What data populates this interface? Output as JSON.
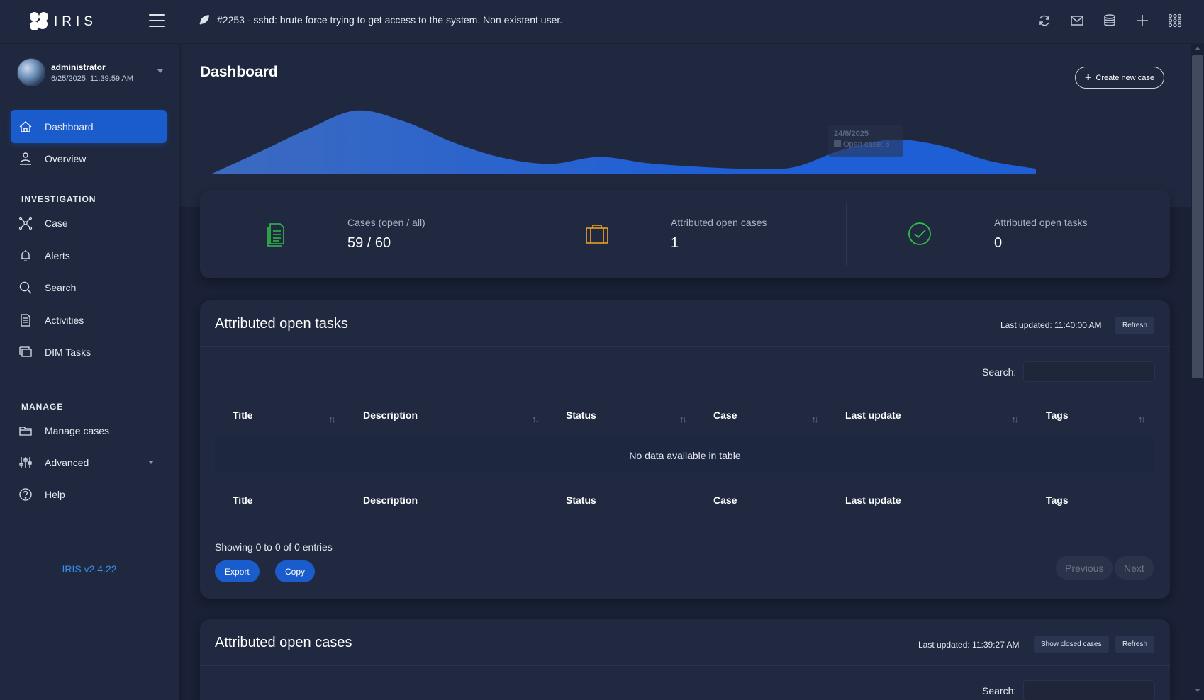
{
  "app": {
    "logo_text": "IRIS",
    "version": "IRIS v2.4.22"
  },
  "topbar": {
    "notification": "#2253 - sshd: brute force trying to get access to the system. Non existent user."
  },
  "user": {
    "name": "administrator",
    "date": "6/25/2025, 11:39:59 AM"
  },
  "sidebar": {
    "items_top": [
      {
        "label": "Dashboard",
        "icon": "home-icon",
        "active": true
      },
      {
        "label": "Overview",
        "icon": "overview-icon"
      }
    ],
    "section_investigation": "INVESTIGATION",
    "items_investigation": [
      {
        "label": "Case",
        "icon": "case-icon"
      },
      {
        "label": "Alerts",
        "icon": "bell-icon"
      },
      {
        "label": "Search",
        "icon": "search-icon"
      },
      {
        "label": "Activities",
        "icon": "document-icon"
      },
      {
        "label": "DIM Tasks",
        "icon": "tasks-icon"
      }
    ],
    "section_manage": "MANAGE",
    "items_manage": [
      {
        "label": "Manage cases",
        "icon": "folder-icon"
      },
      {
        "label": "Advanced",
        "icon": "sliders-icon"
      },
      {
        "label": "Help",
        "icon": "help-icon"
      }
    ]
  },
  "dashboard": {
    "title": "Dashboard",
    "create_button": "Create new case",
    "create_icon": "+",
    "chart_tooltip": {
      "date": "24/6/2025",
      "label": "Open case: 8"
    }
  },
  "stats": [
    {
      "label": "Cases (open / all)",
      "value": "59 / 60",
      "icon": "cases-icon",
      "color": "#2fbf4a"
    },
    {
      "label": "Attributed open cases",
      "value": "1",
      "icon": "briefcase-icon",
      "color": "#f5a623"
    },
    {
      "label": "Attributed open tasks",
      "value": "0",
      "icon": "check-circle-icon",
      "color": "#2fbf4a"
    }
  ],
  "tasks_panel": {
    "title": "Attributed open tasks",
    "last_updated": "Last updated: 11:40:00 AM",
    "refresh": "Refresh",
    "search_label": "Search:",
    "columns": [
      "Title",
      "Description",
      "Status",
      "Case",
      "Last update",
      "Tags"
    ],
    "empty_text": "No data available in table",
    "showing": "Showing 0 to 0 of 0 entries",
    "export": "Export",
    "copy": "Copy",
    "previous": "Previous",
    "next": "Next"
  },
  "cases_panel": {
    "title": "Attributed open cases",
    "last_updated": "Last updated: 11:39:27 AM",
    "show_closed": "Show closed cases",
    "refresh": "Refresh",
    "search_label": "Search:"
  },
  "chart_data": {
    "type": "area",
    "x": [
      "",
      "",
      "",
      "",
      "",
      "",
      "",
      "",
      "",
      "",
      "",
      "",
      "24/6/2025",
      "",
      "",
      "",
      "",
      ""
    ],
    "series": [
      {
        "name": "Open case",
        "values": [
          0,
          3.2,
          6.5,
          9.2,
          7.6,
          4.6,
          2.4,
          1.5,
          2.5,
          1.6,
          1.1,
          0.8,
          1.0,
          3.5,
          5.0,
          4.2,
          2.0,
          0.8
        ]
      }
    ],
    "title": "",
    "xlabel": "",
    "ylabel": "",
    "color": "#1f5fd6"
  }
}
